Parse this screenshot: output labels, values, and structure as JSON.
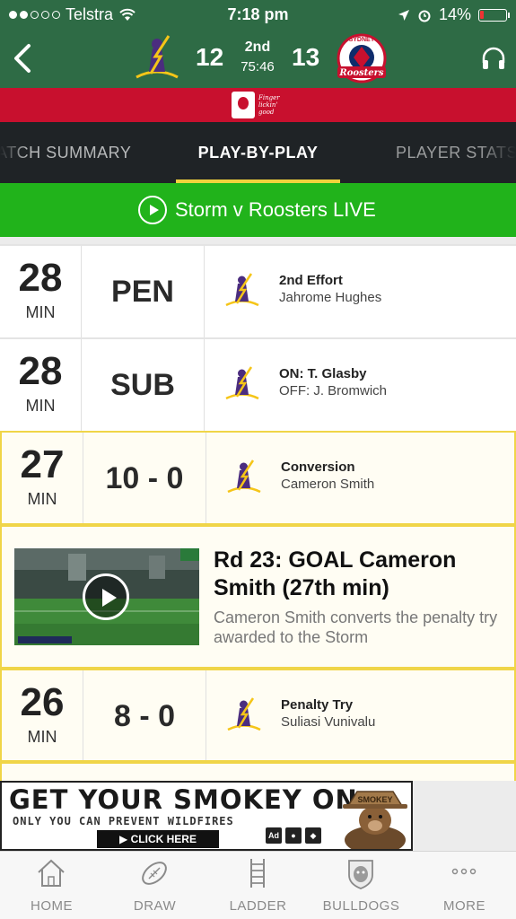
{
  "status_bar": {
    "carrier": "Telstra",
    "time": "7:18 pm",
    "battery": "14%",
    "battery_level": 0.14
  },
  "match_header": {
    "home_score": "12",
    "period": "2nd",
    "clock": "75:46",
    "away_score": "13",
    "home_team_icon": "storm-logo",
    "away_team_icon": "sydney-roosters-logo",
    "away_logo_text": "SYDNEY",
    "away_logo_wordmark": "Roosters"
  },
  "sponsor": {
    "name": "KFC",
    "tagline_1": "Finger",
    "tagline_2": "lickin'",
    "tagline_3": "good"
  },
  "tabs": [
    {
      "label": "ATCH SUMMARY"
    },
    {
      "label": "PLAY-BY-PLAY"
    },
    {
      "label": "PLAYER STATS"
    }
  ],
  "live_bar": {
    "label": "Storm v Roosters LIVE"
  },
  "events": [
    {
      "minute": "28",
      "unit": "MIN",
      "type": "PEN",
      "title": "2nd Effort",
      "subtitle": "Jahrome Hughes"
    },
    {
      "minute": "28",
      "unit": "MIN",
      "type": "SUB",
      "title": "ON: T. Glasby",
      "subtitle": "OFF: J. Bromwich"
    },
    {
      "minute": "27",
      "unit": "MIN",
      "type": "10 - 0",
      "title": "Conversion",
      "subtitle": "Cameron Smith"
    },
    {
      "minute": "26",
      "unit": "MIN",
      "type": "8 - 0",
      "title": "Penalty Try",
      "subtitle": "Suliasi Vunivalu"
    }
  ],
  "video": {
    "title": "Rd 23: GOAL Cameron Smith (27th min)",
    "description": "Cameron Smith converts the penalty try awarded to the Storm"
  },
  "ad": {
    "headline": "GET YOUR SMOKEY ON",
    "tagline": "ONLY YOU CAN PREVENT WILDFIRES",
    "cta": "▶ CLICK HERE",
    "badge_1": "Ad",
    "hat_text": "SMOKEY"
  },
  "tab_bar": [
    {
      "label": "HOME",
      "icon": "home-icon"
    },
    {
      "label": "DRAW",
      "icon": "football-icon"
    },
    {
      "label": "LADDER",
      "icon": "ladder-icon"
    },
    {
      "label": "BULLDOGS",
      "icon": "bulldogs-logo"
    },
    {
      "label": "MORE",
      "icon": "more-icon"
    }
  ],
  "colors": {
    "header_green": "#2e6b45",
    "sponsor_red": "#c8102e",
    "tab_dark": "#1f2326",
    "tab_accent": "#f2d23c",
    "live_green": "#21b31b",
    "highlight_border": "#f0d548"
  }
}
